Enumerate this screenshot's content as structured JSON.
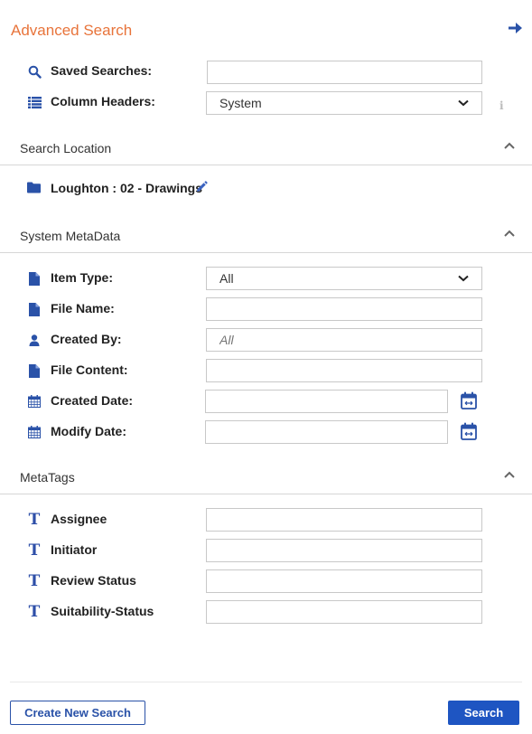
{
  "header": {
    "title": "Advanced Search",
    "collapse_icon": "arrow-right-icon"
  },
  "top_fields": {
    "saved_searches": {
      "label": "Saved Searches:",
      "value": "",
      "icon": "search-icon"
    },
    "column_headers": {
      "label": "Column Headers:",
      "selected": "System",
      "icon": "list-icon",
      "info_icon": "info-icon"
    }
  },
  "sections": {
    "search_location": {
      "title": "Search Location",
      "location": "Loughton : 02 - Drawings",
      "icon": "folder-icon",
      "edit_icon": "pencil-icon"
    },
    "system_metadata": {
      "title": "System MetaData",
      "fields": [
        {
          "label": "Item Type:",
          "type": "select",
          "value": "All",
          "icon": "file-icon"
        },
        {
          "label": "File Name:",
          "type": "text",
          "value": "",
          "icon": "file-icon"
        },
        {
          "label": "Created By:",
          "type": "text",
          "placeholder": "All",
          "icon": "user-icon"
        },
        {
          "label": "File Content:",
          "type": "text",
          "value": "",
          "icon": "file-icon"
        },
        {
          "label": "Created Date:",
          "type": "date",
          "value": "",
          "icon": "calendar-icon"
        },
        {
          "label": "Modify Date:",
          "type": "date",
          "value": "",
          "icon": "calendar-icon"
        }
      ]
    },
    "metatags": {
      "title": "MetaTags",
      "fields": [
        {
          "label": "Assignee",
          "value": "",
          "icon": "text-type-icon"
        },
        {
          "label": "Initiator",
          "value": "",
          "icon": "text-type-icon"
        },
        {
          "label": "Review Status",
          "value": "",
          "icon": "text-type-icon"
        },
        {
          "label": "Suitability-Status",
          "value": "",
          "icon": "text-type-icon"
        }
      ]
    }
  },
  "footer": {
    "create_new_search_label": "Create New Search",
    "search_label": "Search"
  },
  "colors": {
    "title_orange": "#e8743b",
    "icon_blue": "#2a52a8",
    "primary_button": "#1e55c2"
  }
}
